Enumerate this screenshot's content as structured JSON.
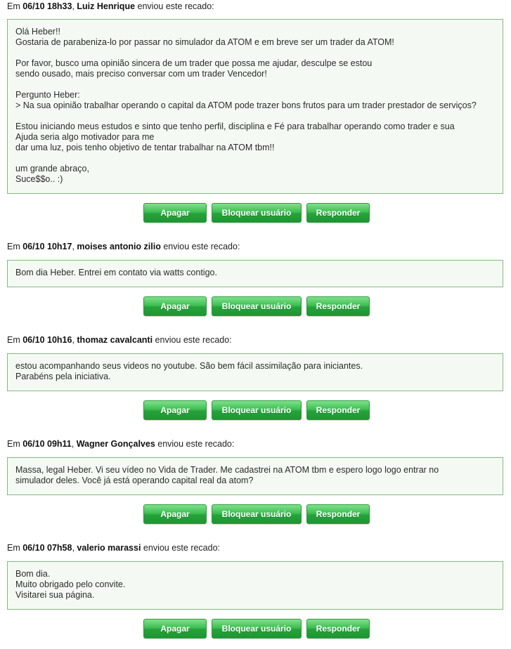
{
  "labels": {
    "prefix": "Em ",
    "suffix": " enviou este recado:",
    "delete": "Apagar",
    "block": "Bloquear usuário",
    "reply": "Responder"
  },
  "messages": [
    {
      "datetime": "06/10 18h33",
      "sender": "Luiz Henrique",
      "lines": [
        "Olá Heber!!",
        "Gostaria de parabeniza-lo por passar no simulador da ATOM e em breve ser um trader da ATOM!",
        "",
        "Por favor, busco uma opinião sincera de um trader que possa me ajudar, desculpe se estou",
        "sendo ousado, mais preciso conversar com um trader Vencedor!",
        "",
        "Pergunto Heber:",
        "> Na sua opinião trabalhar operando o capital da ATOM pode trazer bons frutos para um trader prestador de serviços?",
        "",
        "Estou iniciando meus estudos e sinto que tenho perfil, disciplina e Fé para trabalhar operando como trader e sua",
        "Ajuda seria algo motivador para me",
        "dar uma luz, pois tenho objetivo de tentar trabalhar na ATOM tbm!!",
        "",
        "um grande abraço,",
        "Suce$$o.. :)"
      ]
    },
    {
      "datetime": "06/10 10h17",
      "sender": "moises antonio zilio",
      "lines": [
        "Bom dia Heber. Entrei em contato via watts contigo."
      ]
    },
    {
      "datetime": "06/10 10h16",
      "sender": "thomaz cavalcanti",
      "lines": [
        "estou acompanhando seus videos no youtube. São bem fácil assimilação para iniciantes.",
        "Parabéns pela iniciativa."
      ]
    },
    {
      "datetime": "06/10 09h11",
      "sender": "Wagner Gonçalves",
      "lines": [
        "Massa, legal Heber. Vi seu vídeo no Vida de Trader. Me cadastrei na ATOM tbm e espero logo logo entrar no",
        "simulador deles. Você já está operando capital real da atom?"
      ]
    },
    {
      "datetime": "06/10 07h58",
      "sender": "valerio marassi",
      "lines": [
        "Bom dia.",
        "Muito obrigado pelo convite.",
        "Visitarei sua página."
      ]
    }
  ]
}
